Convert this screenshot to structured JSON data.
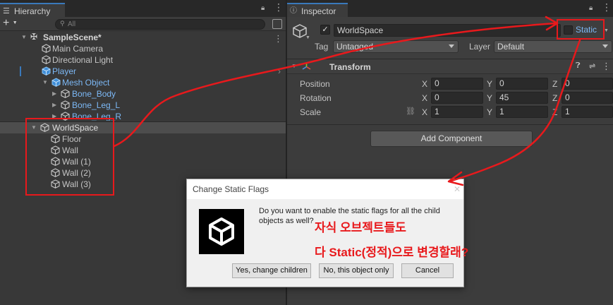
{
  "hierarchy": {
    "tab_label": "Hierarchy",
    "search_placeholder": "All",
    "plus_label": "+",
    "items": [
      {
        "label": "SampleScene*"
      },
      {
        "label": "Main Camera"
      },
      {
        "label": "Directional Light"
      },
      {
        "label": "Player"
      },
      {
        "label": "Mesh Object"
      },
      {
        "label": "Bone_Body"
      },
      {
        "label": "Bone_Leg_L"
      },
      {
        "label": "Bone_Leg_R"
      },
      {
        "label": "WorldSpace"
      },
      {
        "label": "Floor"
      },
      {
        "label": "Wall"
      },
      {
        "label": "Wall (1)"
      },
      {
        "label": "Wall (2)"
      },
      {
        "label": "Wall (3)"
      }
    ]
  },
  "inspector": {
    "tab_label": "Inspector",
    "object_name": "WorldSpace",
    "static_label": "Static",
    "tag_label": "Tag",
    "tag_value": "Untagged",
    "layer_label": "Layer",
    "layer_value": "Default",
    "transform": {
      "title": "Transform",
      "position_label": "Position",
      "rotation_label": "Rotation",
      "scale_label": "Scale",
      "axis_x": "X",
      "axis_y": "Y",
      "axis_z": "Z",
      "position": {
        "x": "0",
        "y": "0",
        "z": "0"
      },
      "rotation": {
        "x": "0",
        "y": "45",
        "z": "0"
      },
      "scale": {
        "x": "1",
        "y": "1",
        "z": "1"
      }
    },
    "add_component_label": "Add Component"
  },
  "dialog": {
    "title": "Change Static Flags",
    "message_line1": "Do you want to enable the static flags for all the child",
    "message_line2": "objects as well?",
    "yes_label": "Yes, change children",
    "no_label": "No, this object only",
    "cancel_label": "Cancel"
  },
  "annotation": {
    "line1": "자식 오브젝트들도",
    "line2": "다 Static(정적)으로 변경할래?",
    "color": "#e8191c"
  },
  "colors": {
    "selection": "#4d4d4d",
    "accent_blue": "#3a79bb",
    "annotation_red": "#e8191c"
  }
}
